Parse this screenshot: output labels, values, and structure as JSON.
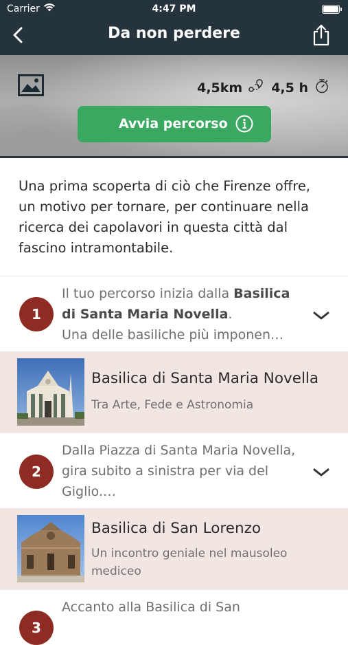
{
  "status_bar": {
    "carrier": "Carrier",
    "time": "4:47 PM"
  },
  "nav": {
    "title": "Da non perdere",
    "back_icon": "chevron-left-icon",
    "share_icon": "share-icon"
  },
  "hero": {
    "image_icon": "image-icon",
    "distance": "4,5km",
    "distance_icon": "route-icon",
    "duration": "4,5 h",
    "duration_icon": "stopwatch-icon",
    "start_button": "Avvia percorso",
    "start_button_color": "#3aa861"
  },
  "description": "Una prima scoperta di ciò che Firenze offre, un motivo per tornare, per continuare nella ricerca dei capolavori in questa città dal fascino intramontabile.",
  "steps": [
    {
      "number": "1",
      "text_before": "Il tuo percorso inizia dalla ",
      "text_bold": "Basilica di Santa Maria Novella",
      "text_after": ".",
      "text_more": "Una delle basiliche più imponen…"
    },
    {
      "number": "2",
      "text": "Dalla Piazza di Santa Maria Novella, gira subito a sinistra per via del Giglio.…"
    },
    {
      "number": "3",
      "text": "Accanto alla Basilica di San"
    }
  ],
  "pois": [
    {
      "title": "Basilica di Santa Maria Novella",
      "subtitle": "Tra Arte, Fede e Astronomia"
    },
    {
      "title": "Basilica di San Lorenzo",
      "subtitle": "Un incontro geniale nel mausoleo mediceo"
    }
  ],
  "colors": {
    "nav_bg": "#25333c",
    "step_badge": "#8e2b22",
    "poi_bg": "#f2e6e3"
  }
}
